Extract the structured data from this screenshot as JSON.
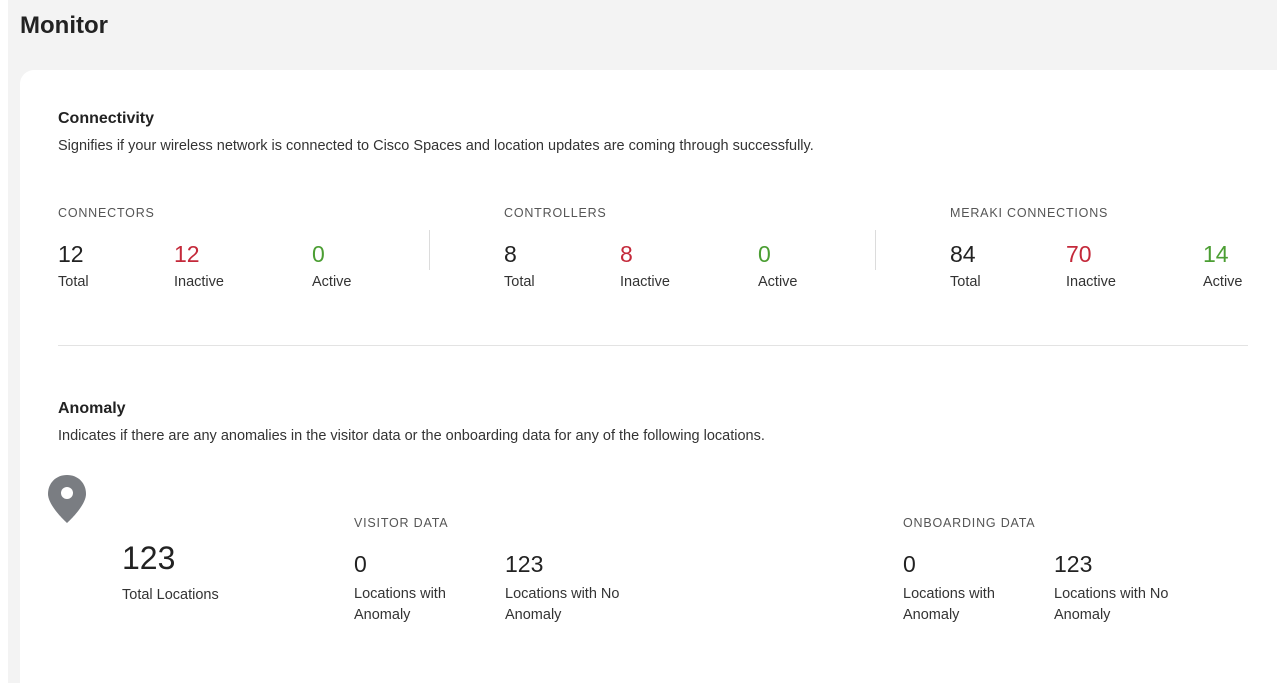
{
  "page": {
    "title": "Monitor"
  },
  "connectivity": {
    "title": "Connectivity",
    "description": "Signifies if your wireless network is connected to Cisco Spaces and location updates are coming through successfully.",
    "groups": [
      {
        "label": "CONNECTORS",
        "total": "12",
        "total_label": "Total",
        "inactive": "12",
        "inactive_label": "Inactive",
        "active": "0",
        "active_label": "Active"
      },
      {
        "label": "CONTROLLERS",
        "total": "8",
        "total_label": "Total",
        "inactive": "8",
        "inactive_label": "Inactive",
        "active": "0",
        "active_label": "Active"
      },
      {
        "label": "MERAKI CONNECTIONS",
        "total": "84",
        "total_label": "Total",
        "inactive": "70",
        "inactive_label": "Inactive",
        "active": "14",
        "active_label": "Active"
      }
    ]
  },
  "anomaly": {
    "title": "Anomaly",
    "description": "Indicates if there are any anomalies in the visitor data or the onboarding data for any of the following locations.",
    "total_locations": "123",
    "total_locations_label": "Total Locations",
    "location_icon": "location-pin-icon",
    "visitor_data": {
      "label": "VISITOR DATA",
      "with_anomaly": "0",
      "with_anomaly_label": "Locations with Anomaly",
      "no_anomaly": "123",
      "no_anomaly_label": "Locations with No Anomaly"
    },
    "onboarding_data": {
      "label": "ONBOARDING DATA",
      "with_anomaly": "0",
      "with_anomaly_label": "Locations with Anomaly",
      "no_anomaly": "123",
      "no_anomaly_label": "Locations with No Anomaly"
    }
  },
  "colors": {
    "inactive": "#c4293a",
    "active": "#4b9e33",
    "icon": "#7a7d82"
  }
}
